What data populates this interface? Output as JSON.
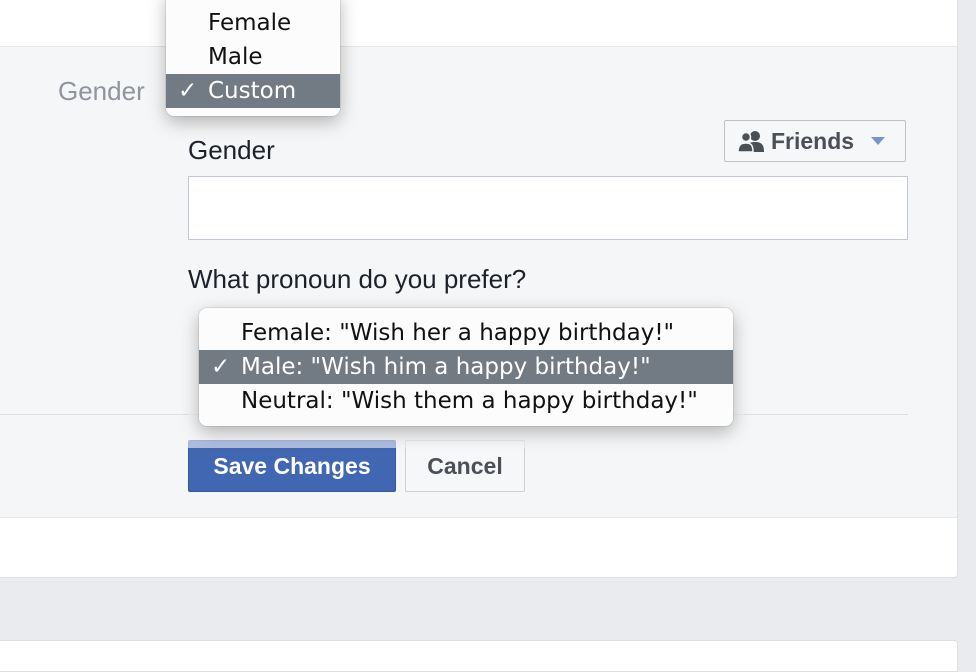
{
  "gender_row": {
    "label": "Gender",
    "menu_items": [
      {
        "label": "Female",
        "selected": false
      },
      {
        "label": "Male",
        "selected": false
      },
      {
        "label": "Custom",
        "selected": true
      }
    ]
  },
  "custom_gender": {
    "field_label": "Gender",
    "input_value": "",
    "privacy": {
      "label": "Friends",
      "icon": "friends-icon"
    }
  },
  "pronoun": {
    "question": "What pronoun do you prefer?",
    "menu_items": [
      {
        "label": "Female: \"Wish her a happy birthday!\"",
        "selected": false
      },
      {
        "label": "Male: \"Wish him a happy birthday!\"",
        "selected": true
      },
      {
        "label": "Neutral: \"Wish them a happy birthday!\"",
        "selected": false
      }
    ]
  },
  "check_mark": "✓",
  "actions": {
    "save_label": "Save Changes",
    "cancel_label": "Cancel"
  },
  "colors": {
    "primary": "#4267b2",
    "menu_selected": "#727a83",
    "page_bg": "#e9ebee"
  }
}
